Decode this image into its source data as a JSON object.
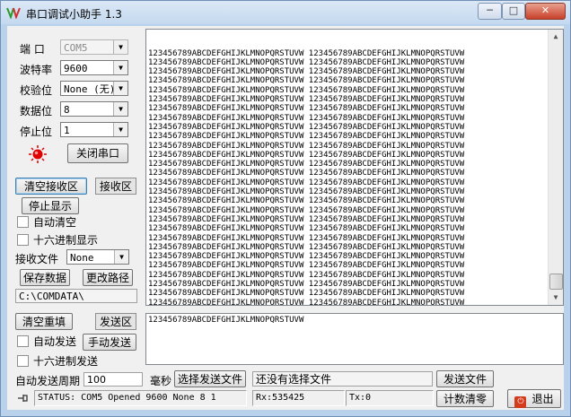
{
  "window": {
    "title": "串口调试小助手 1.3"
  },
  "controls": {
    "buttons": {
      "minimize": "─",
      "maximize": "□",
      "close": "✕"
    }
  },
  "port": {
    "port_label": "端  口",
    "port_value": "COM5",
    "baud_label": "波特率",
    "baud_value": "9600",
    "parity_label": "校验位",
    "parity_value": "None (无)",
    "databits_label": "数据位",
    "databits_value": "8",
    "stopbits_label": "停止位",
    "stopbits_value": "1",
    "toggle_button": "关闭串口",
    "led_color": "#e00000"
  },
  "receive": {
    "clear_button": "清空接收区",
    "area_tab": "接收区",
    "stop_display_button": "停止显示",
    "auto_clear_label": "自动清空",
    "hex_display_label": "十六进制显示",
    "file_label": "接收文件",
    "file_value": "None",
    "save_button": "保存数据",
    "change_path_button": "更改路径",
    "path_value": "C:\\COMDATA\\",
    "line_text": "123456789ABCDEFGHIJKLMNOPQRSTUVW 123456789ABCDEFGHIJKLMNOPQRSTUVW",
    "last_line_text": "123456789ABCDEFGHIJKLMNOPQRSTUVW",
    "line_count": 30
  },
  "send": {
    "clear_button": "清空重填",
    "area_tab": "发送区",
    "auto_send_label": "自动发送",
    "manual_send_button": "手动发送",
    "hex_send_label": "十六进制发送",
    "text": "123456789ABCDEFGHIJKLMNOPQRSTUVW",
    "period_label": "自动发送周期",
    "period_value": "100",
    "period_unit": "毫秒",
    "choose_file_button": "选择发送文件",
    "file_status": "还没有选择文件",
    "send_file_button": "发送文件"
  },
  "statusbar": {
    "status_text": "STATUS: COM5 Opened 9600 None  8 1",
    "rx_text": "Rx:535425",
    "tx_text": "Tx:0",
    "reset_count_button": "计数清零",
    "exit_button": "退出"
  }
}
